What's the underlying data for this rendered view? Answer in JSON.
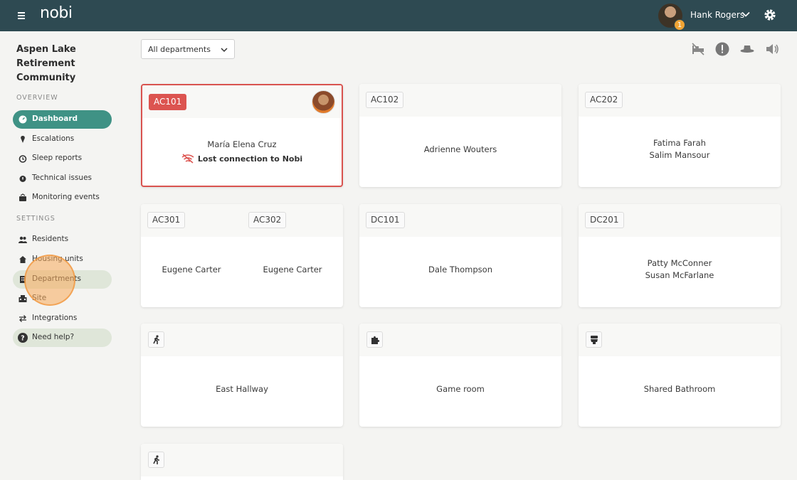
{
  "topbar": {
    "logo": "nobi",
    "user_name": "Hank Rogers",
    "notification_count": "1"
  },
  "sidebar": {
    "community_name": "Aspen Lake Retirement Community",
    "overview_label": "OVERVIEW",
    "overview_items": [
      {
        "label": "Dashboard",
        "icon": "dashboard-icon"
      },
      {
        "label": "Escalations",
        "icon": "escalation-icon"
      },
      {
        "label": "Sleep reports",
        "icon": "alarm-clock-icon"
      },
      {
        "label": "Technical issues",
        "icon": "alarm-icon"
      },
      {
        "label": "Monitoring events",
        "icon": "monitoring-icon"
      }
    ],
    "settings_label": "SETTINGS",
    "settings_items": [
      {
        "label": "Residents",
        "icon": "people-icon"
      },
      {
        "label": "Housing units",
        "icon": "house-icon"
      },
      {
        "label": "Departments",
        "icon": "building-icon"
      },
      {
        "label": "Site",
        "icon": "site-icon"
      },
      {
        "label": "Integrations",
        "icon": "arrows-icon"
      },
      {
        "label": "Need help?",
        "icon": "help-icon"
      }
    ]
  },
  "toolbar": {
    "department_filter": "All departments",
    "icons": [
      "bed-icon",
      "alert-icon",
      "hat-icon",
      "speaker-icon"
    ]
  },
  "rooms": [
    {
      "tag": "AC101",
      "resident": "María Elena Cruz",
      "status": "Lost connection to Nobi"
    },
    {
      "tag": "AC102",
      "resident": "Adrienne Wouters"
    },
    {
      "tag": "AC202",
      "residents": [
        "Fatima Farah",
        "Salim Mansour"
      ]
    },
    {
      "tag_a": "AC301",
      "resident_a": "Eugene Carter",
      "tag_b": "AC302",
      "resident_b": "Eugene Carter"
    },
    {
      "tag": "DC101",
      "resident": "Dale Thompson"
    },
    {
      "tag": "DC201",
      "residents": [
        "Patty McConner",
        "Susan McFarlane"
      ]
    },
    {
      "icon": "walking-icon",
      "name": "East Hallway"
    },
    {
      "icon": "puzzle-icon",
      "name": "Game room"
    },
    {
      "icon": "toilet-icon",
      "name": "Shared Bathroom"
    },
    {
      "icon": "walking-icon",
      "name": ""
    }
  ],
  "colors": {
    "topbar": "#2e4a52",
    "accent": "#3f9285",
    "alert": "#dc5450",
    "highlight": "#dfe6d9"
  }
}
